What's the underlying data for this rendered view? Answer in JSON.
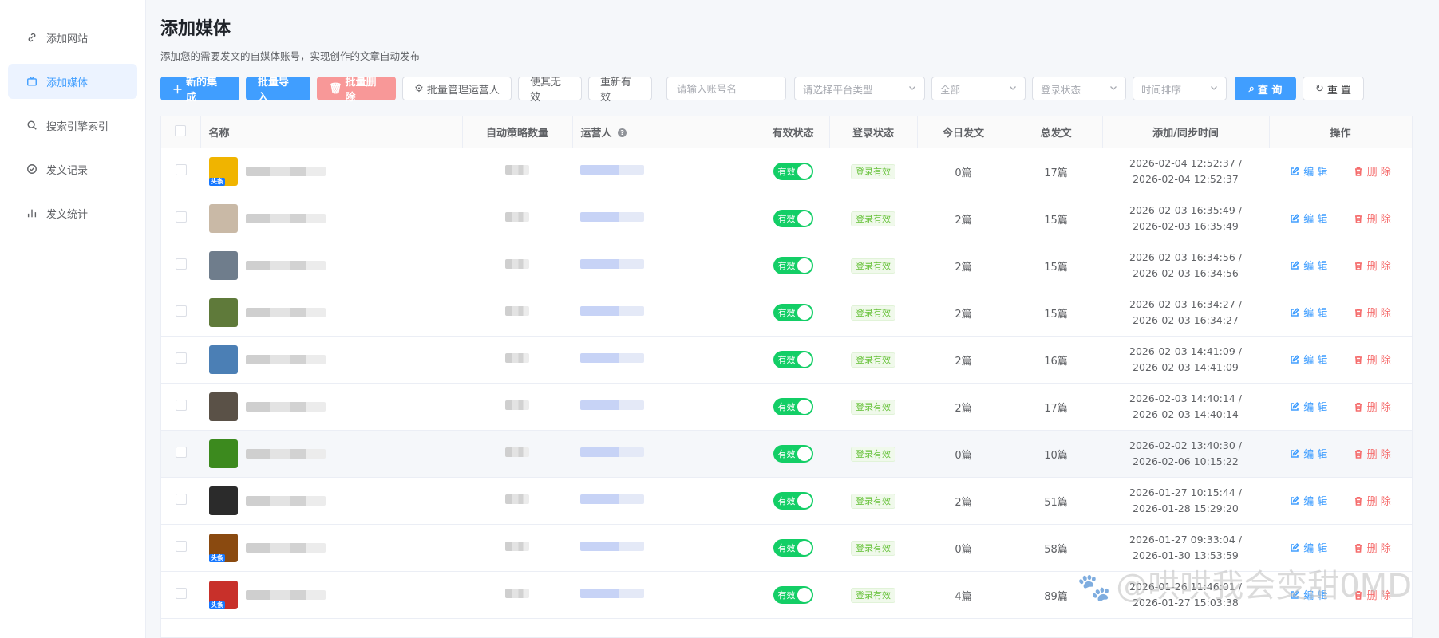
{
  "sidebar": {
    "items": [
      {
        "label": "添加网站",
        "icon": "link-icon",
        "active": false
      },
      {
        "label": "添加媒体",
        "icon": "tv-icon",
        "active": true
      },
      {
        "label": "搜索引擎索引",
        "icon": "search-icon",
        "active": false
      },
      {
        "label": "发文记录",
        "icon": "check-circle-icon",
        "active": false
      },
      {
        "label": "发文统计",
        "icon": "bar-chart-icon",
        "active": false
      }
    ]
  },
  "header": {
    "title": "添加媒体",
    "subtitle": "添加您的需要发文的自媒体账号，实现创作的文章自动发布"
  },
  "toolbar": {
    "new_label": "新的集成",
    "import_label": "批量导入",
    "delete_label": "批量删除",
    "manage_label": "批量管理运营人",
    "invalid_label": "使其无效",
    "revalid_label": "重新有效",
    "account_placeholder": "请输入账号名",
    "platform_placeholder": "请选择平台类型",
    "status_value": "全部",
    "login_placeholder": "登录状态",
    "sort_placeholder": "时间排序",
    "query_label": "查 询",
    "reset_label": "重 置"
  },
  "table": {
    "columns": {
      "name": "名称",
      "strategy": "自动策略数量",
      "operator": "运营人",
      "valid": "有效状态",
      "login": "登录状态",
      "today": "今日发文",
      "total": "总发文",
      "time": "添加/同步时间",
      "actions": "操作"
    },
    "valid_label": "有效",
    "login_label": "登录有效",
    "edit_label": "编 辑",
    "delete_label": "删 除",
    "rows": [
      {
        "today": "0篇",
        "total": "17篇",
        "added": "2026-02-04 12:52:37",
        "synced": "2026-02-04 12:52:37",
        "badge": "头条",
        "avatar_color": "#f0b400"
      },
      {
        "today": "2篇",
        "total": "15篇",
        "added": "2026-02-03 16:35:49",
        "synced": "2026-02-03 16:35:49",
        "badge": "",
        "avatar_color": "#c9b9a6"
      },
      {
        "today": "2篇",
        "total": "15篇",
        "added": "2026-02-03 16:34:56",
        "synced": "2026-02-03 16:34:56",
        "badge": "",
        "avatar_color": "#6f7d8c"
      },
      {
        "today": "2篇",
        "total": "15篇",
        "added": "2026-02-03 16:34:27",
        "synced": "2026-02-03 16:34:27",
        "badge": "",
        "avatar_color": "#5f7a3a"
      },
      {
        "today": "2篇",
        "total": "16篇",
        "added": "2026-02-03 14:41:09",
        "synced": "2026-02-03 14:41:09",
        "badge": "",
        "avatar_color": "#4b7fb5"
      },
      {
        "today": "2篇",
        "total": "17篇",
        "added": "2026-02-03 14:40:14",
        "synced": "2026-02-03 14:40:14",
        "badge": "",
        "avatar_color": "#5a5147"
      },
      {
        "today": "0篇",
        "total": "10篇",
        "added": "2026-02-02 13:40:30",
        "synced": "2026-02-06 10:15:22",
        "badge": "",
        "avatar_color": "#3c8a1e"
      },
      {
        "today": "2篇",
        "total": "51篇",
        "added": "2026-01-27 10:15:44",
        "synced": "2026-01-28 15:29:20",
        "badge": "",
        "avatar_color": "#2b2b2b"
      },
      {
        "today": "0篇",
        "total": "58篇",
        "added": "2026-01-27 09:33:04",
        "synced": "2026-01-30 13:53:59",
        "badge": "头条",
        "avatar_color": "#8a4a10"
      },
      {
        "today": "4篇",
        "total": "89篇",
        "added": "2026-01-26 11:46:01",
        "synced": "2026-01-27 15:03:38",
        "badge": "头条",
        "avatar_color": "#c8302a"
      }
    ]
  },
  "watermark": "@哄哄我会变甜0MD",
  "colors": {
    "primary": "#409eff",
    "success": "#13ce66",
    "danger": "#f56c6c"
  }
}
